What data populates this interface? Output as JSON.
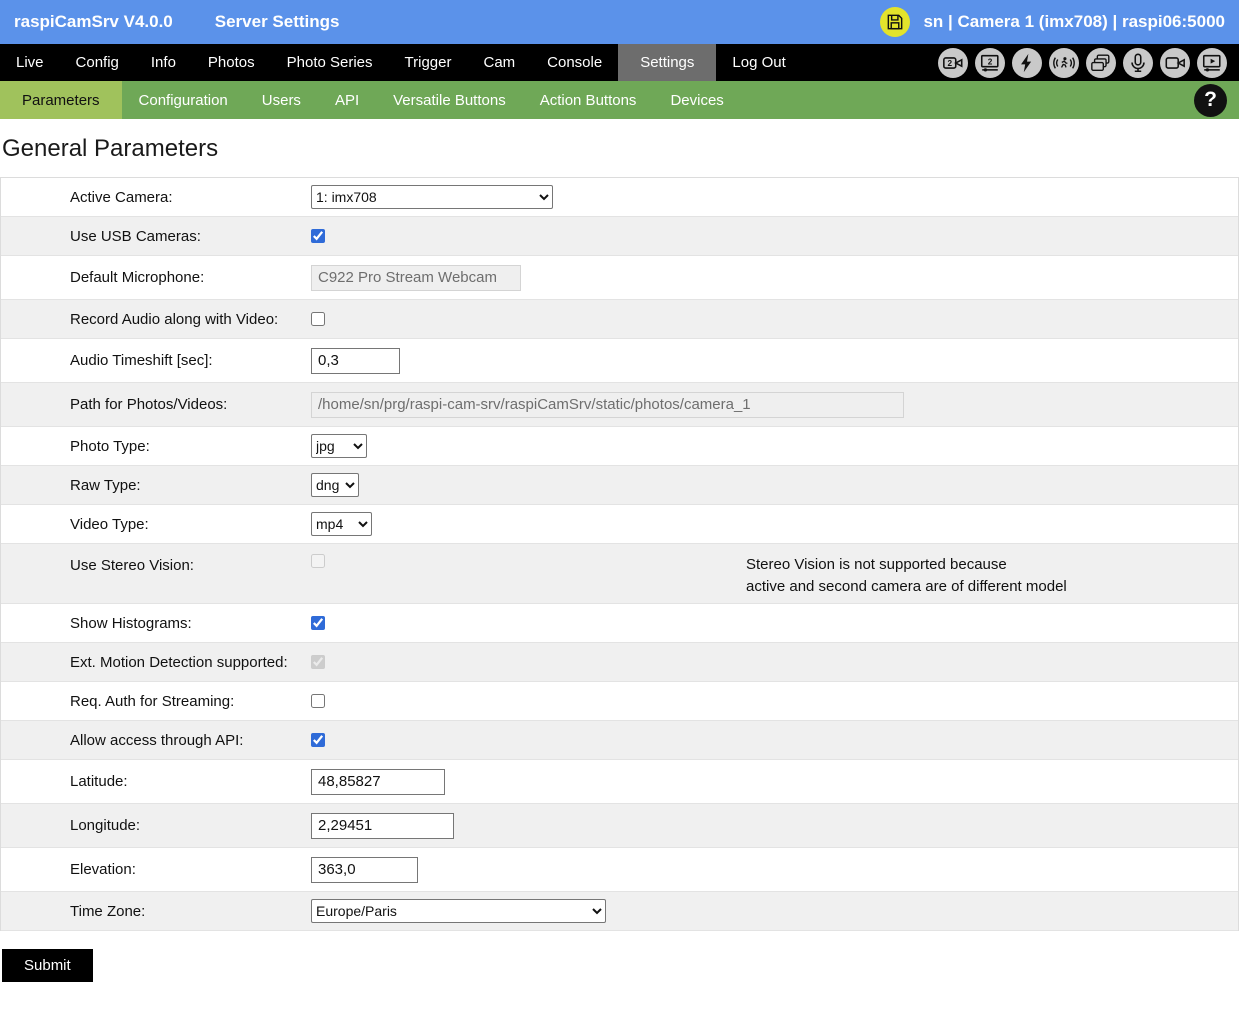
{
  "header": {
    "app_title": "raspiCamSrv V4.0.0",
    "page_title": "Server Settings",
    "save_icon": "floppy-disk-icon",
    "status_text": "sn | Camera 1 (imx708) | raspi06:5000"
  },
  "nav": {
    "items": [
      {
        "label": "Live",
        "active": false
      },
      {
        "label": "Config",
        "active": false
      },
      {
        "label": "Info",
        "active": false
      },
      {
        "label": "Photos",
        "active": false
      },
      {
        "label": "Photo Series",
        "active": false
      },
      {
        "label": "Trigger",
        "active": false
      },
      {
        "label": "Cam",
        "active": false
      },
      {
        "label": "Console",
        "active": false
      },
      {
        "label": "Settings",
        "active": true
      },
      {
        "label": "Log Out",
        "active": false
      }
    ],
    "icons": [
      "camera-2-icon",
      "screen-2-icon",
      "flash-icon",
      "motion-detection-icon",
      "photo-series-icon",
      "microphone-icon",
      "video-camera-icon",
      "stream-player-icon"
    ]
  },
  "subnav": {
    "items": [
      {
        "label": "Parameters",
        "active": true
      },
      {
        "label": "Configuration",
        "active": false
      },
      {
        "label": "Users",
        "active": false
      },
      {
        "label": "API",
        "active": false
      },
      {
        "label": "Versatile Buttons",
        "active": false
      },
      {
        "label": "Action Buttons",
        "active": false
      },
      {
        "label": "Devices",
        "active": false
      }
    ],
    "help_glyph": "?"
  },
  "main": {
    "heading": "General Parameters",
    "submit_label": "Submit",
    "rows": [
      {
        "id": "active-camera",
        "label": "Active Camera:",
        "control": {
          "type": "select",
          "value": "1: imx708",
          "disabled": false
        }
      },
      {
        "id": "use-usb-cameras",
        "label": "Use USB Cameras:",
        "control": {
          "type": "checkbox",
          "checked": true,
          "disabled": false
        }
      },
      {
        "id": "default-microphone",
        "label": "Default Microphone:",
        "control": {
          "type": "text",
          "value": "C922 Pro Stream Webcam",
          "disabled": true
        }
      },
      {
        "id": "record-audio",
        "label": "Record Audio along with Video:",
        "control": {
          "type": "checkbox",
          "checked": false,
          "disabled": false
        }
      },
      {
        "id": "audio-timeshift",
        "label": "Audio Timeshift [sec]:",
        "control": {
          "type": "text",
          "value": "0,3",
          "disabled": false
        }
      },
      {
        "id": "path-photos",
        "label": "Path for Photos/Videos:",
        "control": {
          "type": "text",
          "value": "/home/sn/prg/raspi-cam-srv/raspiCamSrv/static/photos/camera_1",
          "disabled": true
        }
      },
      {
        "id": "photo-type",
        "label": "Photo Type:",
        "control": {
          "type": "select",
          "value": "jpg",
          "disabled": false
        }
      },
      {
        "id": "raw-type",
        "label": "Raw Type:",
        "control": {
          "type": "select",
          "value": "dng",
          "disabled": false
        }
      },
      {
        "id": "video-type",
        "label": "Video Type:",
        "control": {
          "type": "select",
          "value": "mp4",
          "disabled": false
        }
      },
      {
        "id": "use-stereo-vision",
        "label": "Use Stereo Vision:",
        "control": {
          "type": "checkbox",
          "checked": false,
          "disabled": true
        },
        "note": [
          "Stereo Vision is not supported because",
          "active and second camera are of different model"
        ]
      },
      {
        "id": "show-histograms",
        "label": "Show Histograms:",
        "control": {
          "type": "checkbox",
          "checked": true,
          "disabled": false
        }
      },
      {
        "id": "ext-motion-detection",
        "label": "Ext. Motion Detection supported:",
        "control": {
          "type": "checkbox",
          "checked": true,
          "disabled": true
        }
      },
      {
        "id": "req-auth-streaming",
        "label": "Req. Auth for Streaming:",
        "control": {
          "type": "checkbox",
          "checked": false,
          "disabled": false
        }
      },
      {
        "id": "allow-api",
        "label": "Allow access through API:",
        "control": {
          "type": "checkbox",
          "checked": true,
          "disabled": false
        }
      },
      {
        "id": "latitude",
        "label": "Latitude:",
        "control": {
          "type": "text",
          "value": "48,85827",
          "disabled": false
        }
      },
      {
        "id": "longitude",
        "label": "Longitude:",
        "control": {
          "type": "text",
          "value": "2,29451",
          "disabled": false
        }
      },
      {
        "id": "elevation",
        "label": "Elevation:",
        "control": {
          "type": "text",
          "value": "363,0",
          "disabled": false
        }
      },
      {
        "id": "time-zone",
        "label": "Time Zone:",
        "control": {
          "type": "select",
          "value": "Europe/Paris",
          "disabled": false
        }
      }
    ]
  },
  "colors": {
    "header-bg": "#5b92ea",
    "nav-bg": "#000000",
    "nav-active-bg": "#6d6d6d",
    "subnav-bg": "#6fa857",
    "subnav-active-bg": "#a0c25c",
    "row-alt-bg": "#f0f0f0",
    "save-icon-bg": "#e3e32b",
    "checkbox-accent": "#2f6bd8",
    "submit-bg": "#000000"
  }
}
